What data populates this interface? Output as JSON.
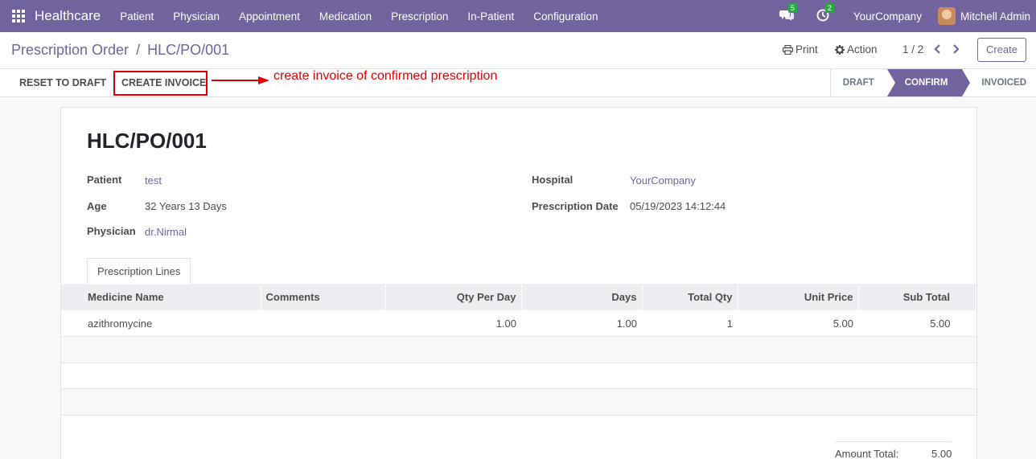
{
  "navbar": {
    "brand": "Healthcare",
    "menu": [
      "Patient",
      "Physician",
      "Appointment",
      "Medication",
      "Prescription",
      "In-Patient",
      "Configuration"
    ],
    "messages_count": "5",
    "activities_count": "2",
    "company": "YourCompany",
    "user": "Mitchell Admin"
  },
  "control": {
    "breadcrumb_parent": "Prescription Order",
    "breadcrumb_sep": "/",
    "breadcrumb_current": "HLC/PO/001",
    "print_label": "Print",
    "action_label": "Action",
    "pager": "1 / 2",
    "create_label": "Create"
  },
  "statusbar": {
    "reset_label": "RESET TO DRAFT",
    "invoice_label": "CREATE INVOICE",
    "annotation": "create invoice of confirmed prescription",
    "stages": [
      "DRAFT",
      "CONFIRM",
      "INVOICED"
    ],
    "active_stage": "CONFIRM"
  },
  "form": {
    "title": "HLC/PO/001",
    "patient_label": "Patient",
    "patient": "test",
    "age_label": "Age",
    "age": "32 Years 13 Days",
    "physician_label": "Physician",
    "physician": "dr.Nirmal",
    "hospital_label": "Hospital",
    "hospital": "YourCompany",
    "date_label": "Prescription Date",
    "date": "05/19/2023 14:12:44",
    "tab_label": "Prescription Lines"
  },
  "lines": {
    "headers": [
      "Medicine Name",
      "Comments",
      "Qty Per Day",
      "Days",
      "Total Qty",
      "Unit Price",
      "Sub Total"
    ],
    "rows": [
      [
        "azithromycine",
        "",
        "1.00",
        "1.00",
        "1",
        "5.00",
        "5.00"
      ]
    ]
  },
  "totals": {
    "amount_label": "Amount Total:",
    "amount": "5.00"
  },
  "colors": {
    "brand": "#71639e",
    "annotation": "#e00000"
  }
}
